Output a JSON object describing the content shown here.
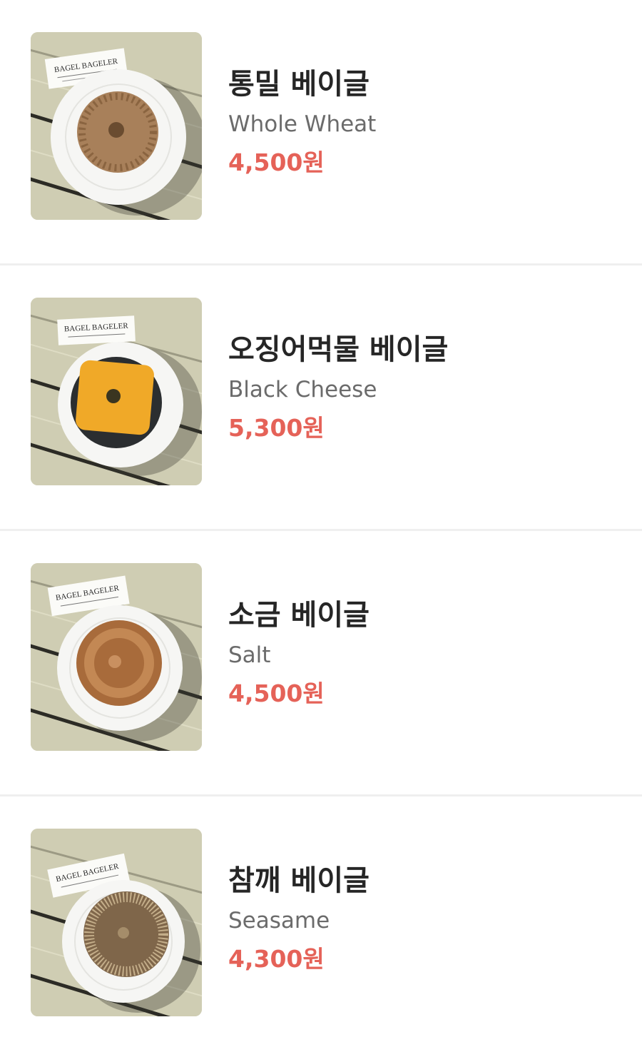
{
  "menu": {
    "items": [
      {
        "name_ko": "통밀 베이글",
        "name_en": "Whole Wheat",
        "price": "4,500원",
        "card_brand": "BAGEL BAGELER",
        "image_icon": "whole-wheat-bagel-photo",
        "bagel_style": "crumble",
        "bagel_color": "#a8805a",
        "accent_color": "#8a6440"
      },
      {
        "name_ko": "오징어먹물 베이글",
        "name_en": "Black Cheese",
        "price": "5,300원",
        "card_brand": "BAGEL BAGELER",
        "image_icon": "black-cheese-bagel-photo",
        "bagel_style": "cheese",
        "bagel_color": "#2b2e30",
        "accent_color": "#f0a928"
      },
      {
        "name_ko": "소금 베이글",
        "name_en": "Salt",
        "price": "4,500원",
        "card_brand": "BAGEL BAGELER",
        "image_icon": "salt-bagel-photo",
        "bagel_style": "plain",
        "bagel_color": "#a86b3b",
        "accent_color": "#d8a06a"
      },
      {
        "name_ko": "참깨 베이글",
        "name_en": "Seasame",
        "price": "4,300원",
        "card_brand": "BAGEL BAGELER",
        "image_icon": "sesame-bagel-photo",
        "bagel_style": "sesame",
        "bagel_color": "#7f664a",
        "accent_color": "#c4ae8a"
      }
    ]
  },
  "colors": {
    "price": "#e56258",
    "name": "#262626",
    "subtitle": "#6b6b6b",
    "divider": "#efefef",
    "wood": "#cdccb2"
  }
}
